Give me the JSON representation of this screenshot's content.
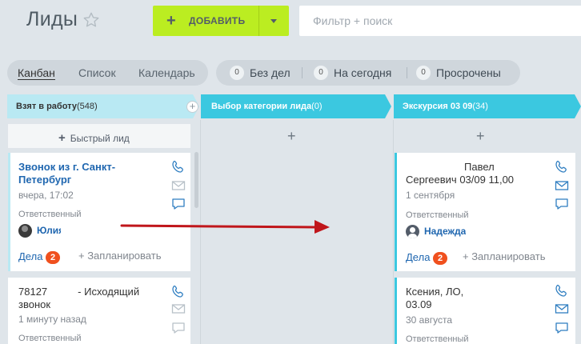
{
  "header": {
    "title": "Лиды",
    "add_button": "ДОБАВИТЬ",
    "search_placeholder": "Фильтр + поиск"
  },
  "views": {
    "kanban": "Канбан",
    "list": "Список",
    "calendar": "Календарь"
  },
  "counters": [
    {
      "count": "0",
      "label": "Без дел"
    },
    {
      "count": "0",
      "label": "На сегодня"
    },
    {
      "count": "0",
      "label": "Просрочены"
    }
  ],
  "columns": [
    {
      "name": "Взят в работу",
      "count": "(548)",
      "color": "#b9e9f3"
    },
    {
      "name": "Выбор категории лида",
      "count": "(0)",
      "color": "#3bc8e0"
    },
    {
      "name": "Экскурсия 03 09",
      "count": "(34)",
      "color": "#3bc8e0"
    }
  ],
  "quick_lead": "Быстрый лид",
  "plus_symbol": "+",
  "cards": {
    "c1": {
      "title": "Звонок из г. Санкт-Петербург",
      "title_line1": "Звонок из г. Санкт-",
      "title_line2": "Петербург",
      "date": "вчера, 17:02",
      "responsible_label": "Ответственный",
      "user": "Юлия",
      "deals_label": "Дела",
      "deals_count": "2",
      "plan": "+ Запланировать"
    },
    "c2": {
      "title_line1": "78127",
      "title_line1b": "- Исходящий",
      "title_line2": "звонок",
      "date": "1 минуту назад",
      "responsible_label": "Ответственный"
    },
    "c3": {
      "title_line1": "Павел",
      "title_line2": "Сергеевич 03/09 11,00",
      "date": "1 сентября",
      "responsible_label": "Ответственный",
      "user": "Надежда",
      "deals_label": "Дела",
      "deals_count": "2",
      "plan": "+ Запланировать"
    },
    "c4": {
      "title_line1": "Ксения, ЛО,",
      "title_line2": "03.09",
      "date": "30 августа",
      "responsible_label": "Ответственный"
    }
  },
  "colors": {
    "accent_green": "#bbed21",
    "link_blue": "#2067b0",
    "badge_red": "#f0501e",
    "arrow_red": "#c0161b"
  },
  "icons": [
    "star-icon",
    "plus-icon",
    "chevron-down-icon",
    "phone-icon",
    "envelope-icon",
    "chat-icon",
    "avatar-icon",
    "arrow-annotation"
  ]
}
